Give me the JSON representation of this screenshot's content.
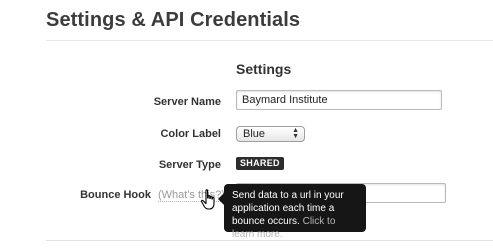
{
  "page": {
    "title": "Settings & API Credentials"
  },
  "section": {
    "title": "Settings"
  },
  "fields": {
    "server_name": {
      "label": "Server Name",
      "value": "Baymard Institute"
    },
    "color_label": {
      "label": "Color Label",
      "selected": "Blue"
    },
    "server_type": {
      "label": "Server Type",
      "badge": "SHARED"
    },
    "bounce_hook": {
      "label": "Bounce Hook",
      "help_link": "(What's this?)",
      "value": ""
    }
  },
  "tooltip": {
    "text": "Send data to a url in your application each time a bounce occurs.",
    "link_text": "Click to learn more."
  },
  "icons": {
    "cursor": "hand-pointer-icon",
    "select_arrows": "up-down-arrows-icon"
  },
  "colors": {
    "badge_bg": "#2d2d2d",
    "tooltip_bg": "#161616",
    "title": "#3c3c3c"
  }
}
